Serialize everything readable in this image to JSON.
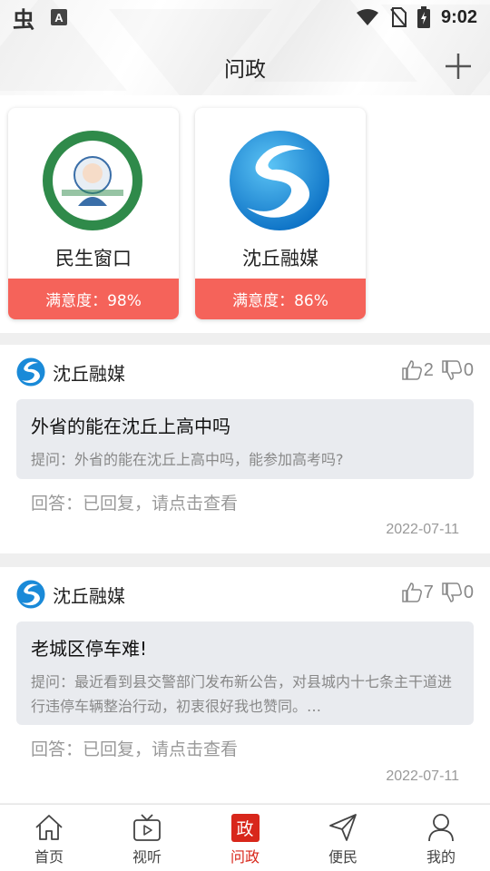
{
  "status_bar": {
    "time": "9:02",
    "app_icon_char": "虫",
    "ime_icon_char": "A"
  },
  "header": {
    "title": "问政"
  },
  "windows": [
    {
      "name": "民生窗口",
      "satisfaction": "满意度：98%",
      "logo": "minsheng-logo"
    },
    {
      "name": "沈丘融媒",
      "satisfaction": "满意度：86%",
      "logo": "shenqiu-logo"
    }
  ],
  "questions": [
    {
      "org": "沈丘融媒",
      "likes": "2",
      "dislikes": "0",
      "title": "外省的能在沈丘上高中吗",
      "body": "提问：外省的能在沈丘上高中吗，能参加高考吗?",
      "answer": "回答：已回复，请点击查看",
      "date": "2022-07-11"
    },
    {
      "org": "沈丘融媒",
      "likes": "7",
      "dislikes": "0",
      "title": "老城区停车难!",
      "body": "提问：最近看到县交警部门发布新公告，对县城内十七条主干道进行违停车辆整治行动，初衷很好我也赞同。…",
      "answer": "回答：已回复，请点击查看",
      "date": "2022-07-11"
    }
  ],
  "tabs": [
    {
      "label": "首页",
      "icon": "home-icon"
    },
    {
      "label": "视听",
      "icon": "tv-icon"
    },
    {
      "label": "问政",
      "icon": "zheng-icon",
      "badge": "政",
      "active": true
    },
    {
      "label": "便民",
      "icon": "send-icon"
    },
    {
      "label": "我的",
      "icon": "user-icon"
    }
  ],
  "colors": {
    "accent_red": "#d8271b",
    "satisfaction_bar": "#f5635a",
    "question_box_bg": "#e9ebef"
  }
}
